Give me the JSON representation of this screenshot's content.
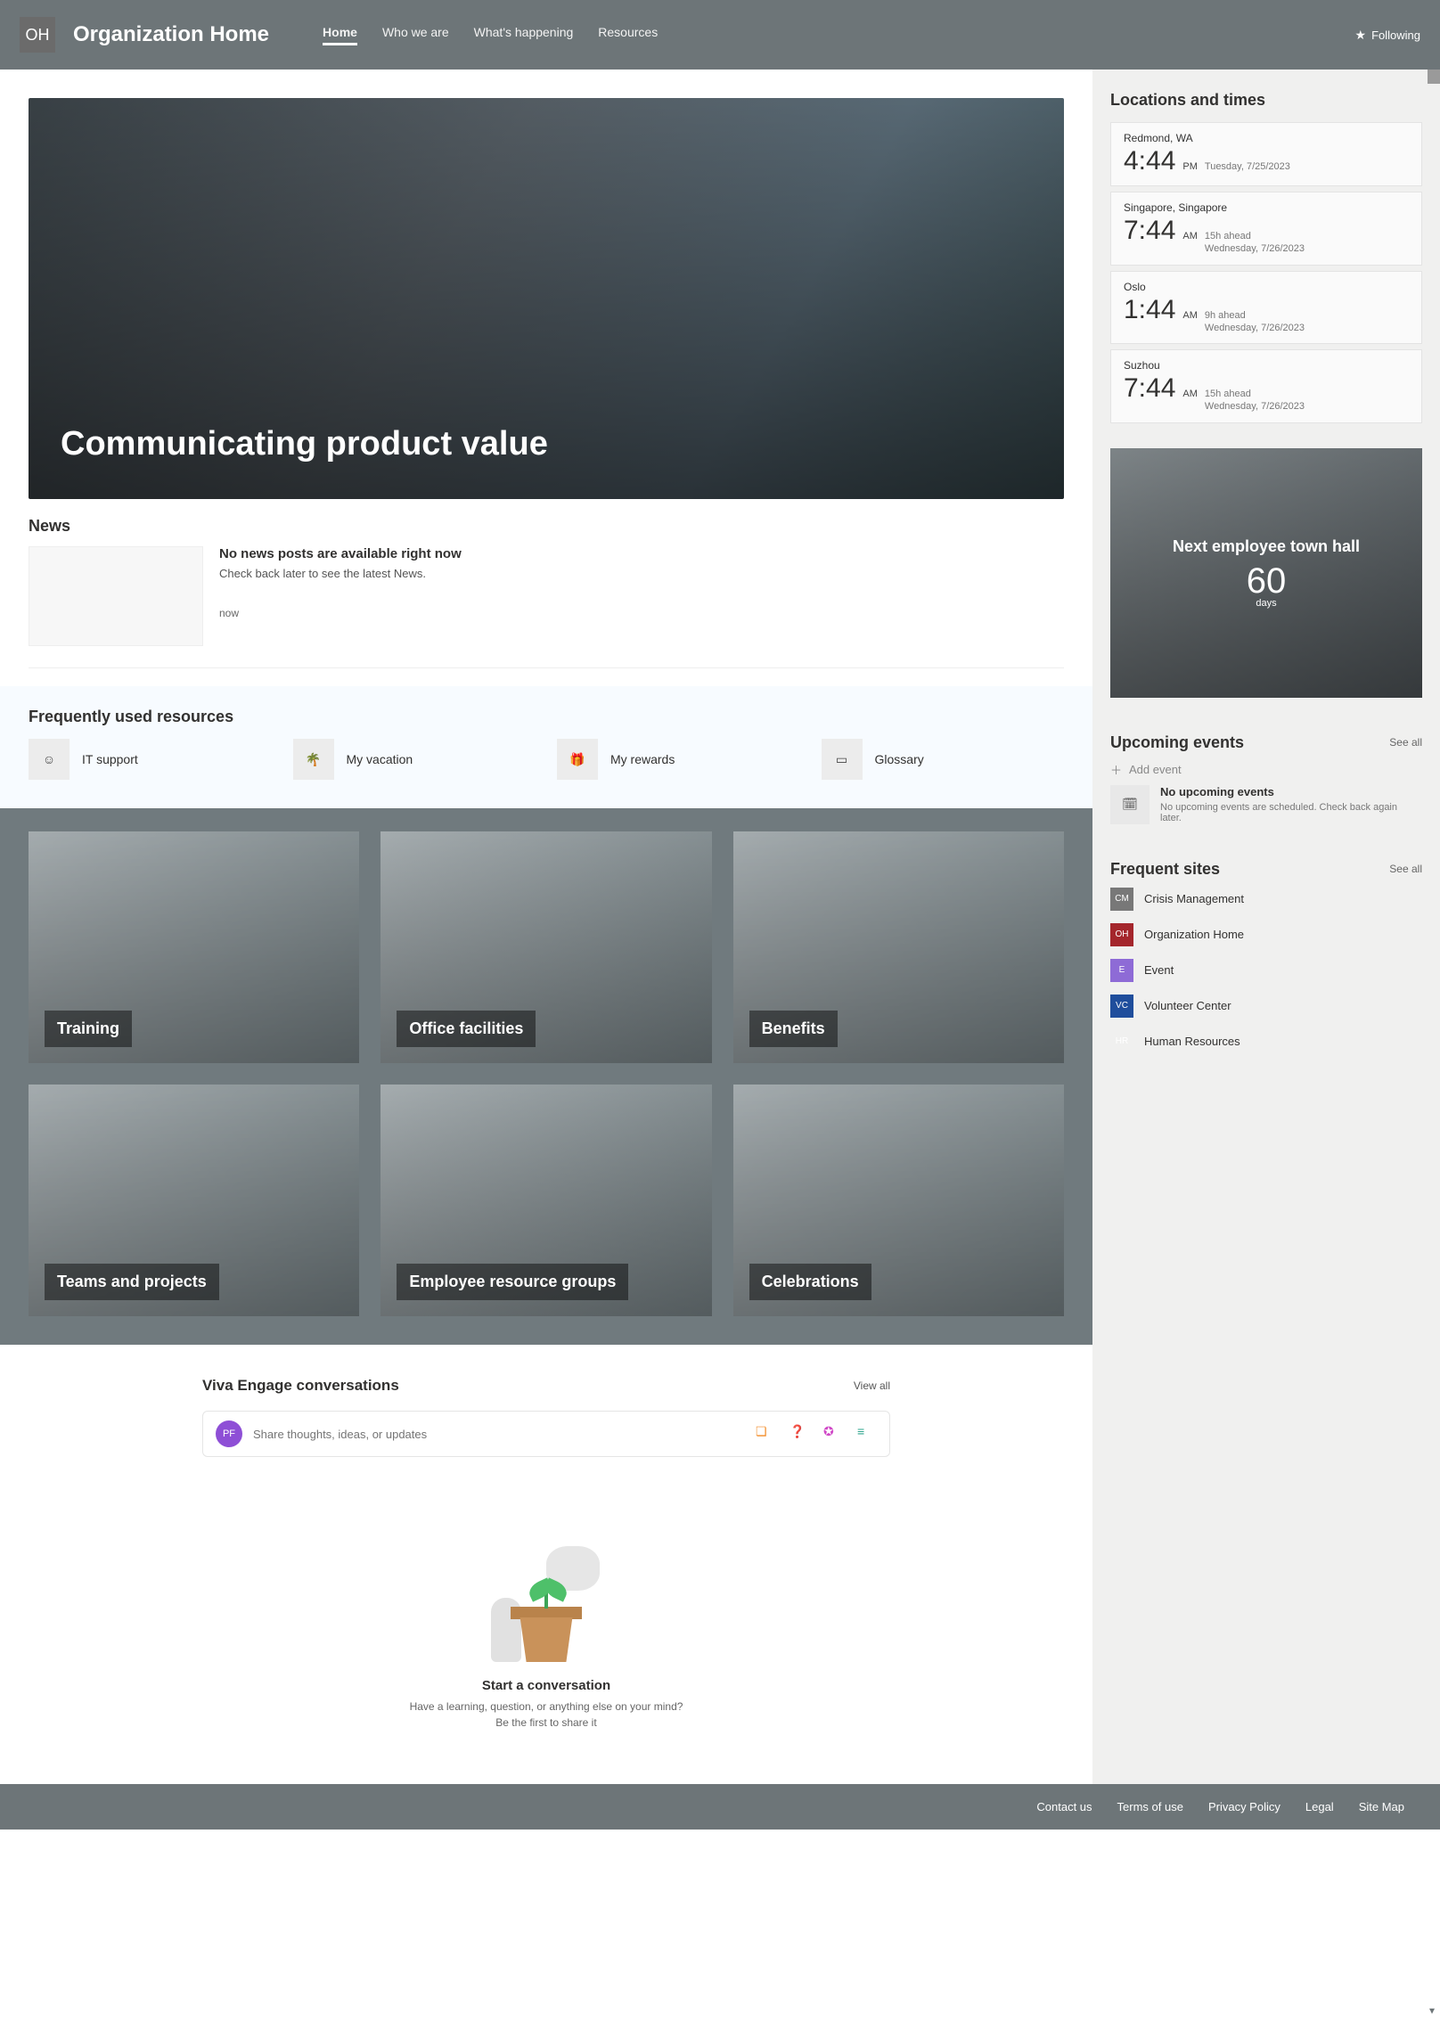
{
  "header": {
    "badge": "OH",
    "title": "Organization Home",
    "nav": [
      "Home",
      "Who we are",
      "What's happening",
      "Resources"
    ],
    "active_nav_index": 0,
    "following": "Following"
  },
  "hero": {
    "title": "Communicating product value"
  },
  "news": {
    "heading": "News",
    "empty_title": "No news posts are available right now",
    "empty_sub": "Check back later to see the latest News.",
    "timestamp": "now"
  },
  "resources": {
    "heading": "Frequently used resources",
    "items": [
      {
        "icon": "person-icon",
        "label": "IT support"
      },
      {
        "icon": "palm-icon",
        "label": "My vacation"
      },
      {
        "icon": "gift-icon",
        "label": "My rewards"
      },
      {
        "icon": "book-icon",
        "label": "Glossary"
      }
    ]
  },
  "tiles": [
    "Training",
    "Office facilities",
    "Benefits",
    "Teams and projects",
    "Employee resource groups",
    "Celebrations"
  ],
  "viva": {
    "heading": "Viva Engage conversations",
    "view_all": "View all",
    "avatar": "PF",
    "placeholder": "Share thoughts, ideas, or updates",
    "start_title": "Start a conversation",
    "start_sub1": "Have a learning, question, or anything else on your mind?",
    "start_sub2": "Be the first to share it"
  },
  "rail": {
    "locations_heading": "Locations and times",
    "locations": [
      {
        "city": "Redmond, WA",
        "time": "4:44",
        "ampm": "PM",
        "ahead": "",
        "date": "Tuesday, 7/25/2023"
      },
      {
        "city": "Singapore, Singapore",
        "time": "7:44",
        "ampm": "AM",
        "ahead": "15h ahead",
        "date": "Wednesday, 7/26/2023"
      },
      {
        "city": "Oslo",
        "time": "1:44",
        "ampm": "AM",
        "ahead": "9h ahead",
        "date": "Wednesday, 7/26/2023"
      },
      {
        "city": "Suzhou",
        "time": "7:44",
        "ampm": "AM",
        "ahead": "15h ahead",
        "date": "Wednesday, 7/26/2023"
      }
    ],
    "townhall": {
      "title": "Next employee town hall",
      "count": "60",
      "unit": "days"
    },
    "upcoming": {
      "heading": "Upcoming events",
      "see_all": "See all",
      "add": "Add event",
      "empty_title": "No upcoming events",
      "empty_sub": "No upcoming events are scheduled. Check back again later."
    },
    "freq_sites": {
      "heading": "Frequent sites",
      "see_all": "See all",
      "items": [
        {
          "abbr": "CM",
          "color": "#6b6b6b",
          "label": "Crisis Management"
        },
        {
          "abbr": "OH",
          "color": "#787878",
          "label": "Organization Home"
        },
        {
          "abbr": "E",
          "color": "#a4262c",
          "label": "Event"
        },
        {
          "abbr": "VC",
          "color": "#8e6bd6",
          "label": "Volunteer Center"
        },
        {
          "abbr": "HR",
          "color": "#1f4e9c",
          "label": "Human Resources"
        }
      ]
    }
  },
  "footer": [
    "Contact us",
    "Terms of use",
    "Privacy Policy",
    "Legal",
    "Site Map"
  ]
}
